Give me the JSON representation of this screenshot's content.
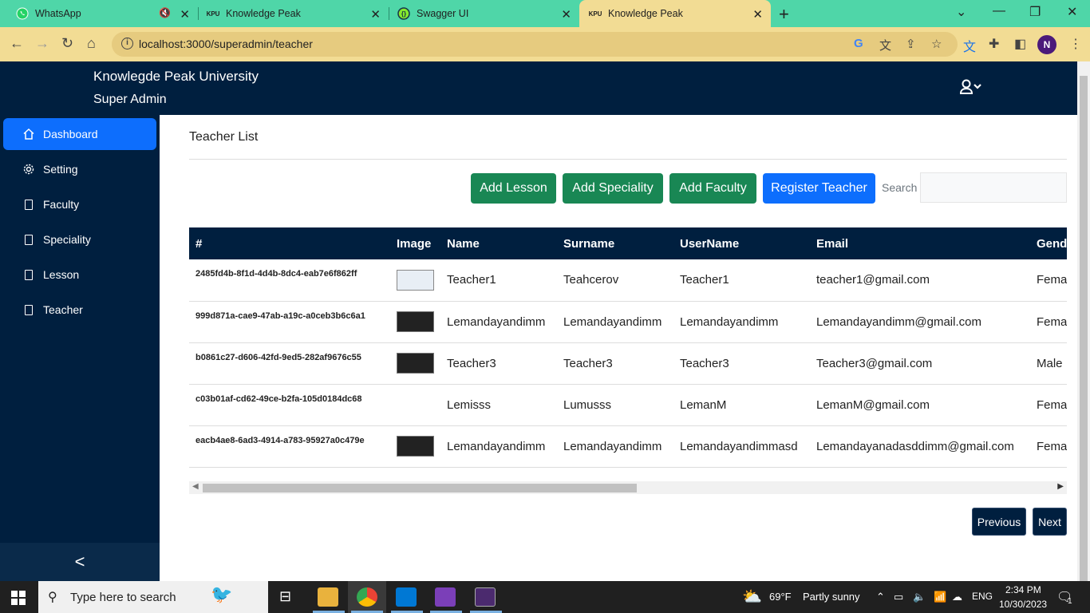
{
  "browser": {
    "tabs": [
      {
        "title": "WhatsApp",
        "favicon": "whatsapp-icon",
        "muted": true
      },
      {
        "title": "Knowledge Peak",
        "favicon": "KPU"
      },
      {
        "title": "Swagger UI",
        "favicon": "swagger-icon"
      },
      {
        "title": "Knowledge Peak",
        "favicon": "KPU",
        "active": true
      }
    ],
    "url": "localhost:3000/superadmin/teacher",
    "profile_initial": "N"
  },
  "header": {
    "university": "Knowlegde Peak University",
    "role": "Super Admin"
  },
  "sidebar": {
    "items": [
      {
        "label": "Dashboard",
        "icon": "home-icon",
        "active": true
      },
      {
        "label": "Setting",
        "icon": "gear-icon"
      },
      {
        "label": "Faculty",
        "icon": "document-icon"
      },
      {
        "label": "Speciality",
        "icon": "document-icon"
      },
      {
        "label": "Lesson",
        "icon": "document-icon"
      },
      {
        "label": "Teacher",
        "icon": "document-icon"
      }
    ],
    "collapse_glyph": "<"
  },
  "main": {
    "title": "Teacher List",
    "buttons": {
      "add_lesson": "Add Lesson",
      "add_speciality": "Add Speciality",
      "add_faculty": "Add Faculty",
      "register_teacher": "Register Teacher"
    },
    "search": {
      "label": "Search",
      "value": "",
      "placeholder": ""
    },
    "table": {
      "headers": [
        "#",
        "Image",
        "Name",
        "Surname",
        "UserName",
        "Email",
        "Gend"
      ],
      "rows": [
        {
          "id": "2485fd4b-8f1d-4d4b-8dc4-eab7e6f862ff",
          "image": "light",
          "name": "Teacher1",
          "surname": "Teahcerov",
          "username": "Teacher1",
          "email": "teacher1@gmail.com",
          "gender": "Fema"
        },
        {
          "id": "999d871a-cae9-47ab-a19c-a0ceb3b6c6a1",
          "image": "dark",
          "name": "Lemandayandimm",
          "surname": "Lemandayandimm",
          "username": "Lemandayandimm",
          "email": "Lemandayandimm@gmail.com",
          "gender": "Fema"
        },
        {
          "id": "b0861c27-d606-42fd-9ed5-282af9676c55",
          "image": "dark",
          "name": "Teacher3",
          "surname": "Teacher3",
          "username": "Teacher3",
          "email": "Teacher3@gmail.com",
          "gender": "Male"
        },
        {
          "id": "c03b01af-cd62-49ce-b2fa-105d0184dc68",
          "image": "none",
          "name": "Lemisss",
          "surname": "Lumusss",
          "username": "LemanM",
          "email": "LemanM@gmail.com",
          "gender": "Fema"
        },
        {
          "id": "eacb4ae8-6ad3-4914-a783-95927a0c479e",
          "image": "dark",
          "name": "Lemandayandimm",
          "surname": "Lemandayandimm",
          "username": "Lemandayandimmasd",
          "email": "Lemandayanadasddimm@gmail.com",
          "gender": "Fema"
        }
      ]
    },
    "pagination": {
      "previous": "Previous",
      "next": "Next"
    }
  },
  "taskbar": {
    "search_placeholder": "Type here to search",
    "weather": {
      "temp": "69°F",
      "condition": "Partly sunny"
    },
    "language": "ENG",
    "time": "2:34 PM",
    "date": "10/30/2023",
    "notification_count": "1"
  },
  "colors": {
    "navy": "#001f3f",
    "primary": "#0d6efd",
    "success": "#198754",
    "tab_strip": "#4fd6a8",
    "active_tab": "#f2dc94"
  }
}
